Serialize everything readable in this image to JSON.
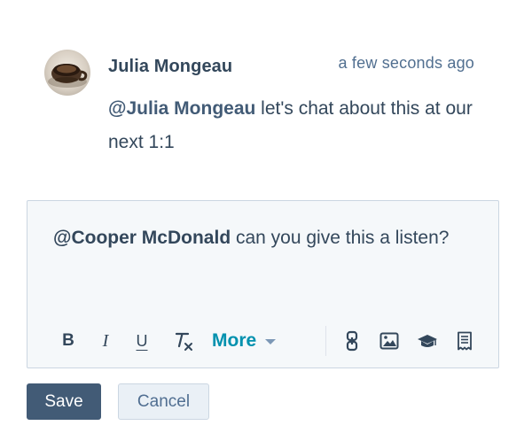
{
  "comment": {
    "author": "Julia Mongeau",
    "timestamp": "a few seconds ago",
    "mention": "@Julia Mongeau",
    "text": " let's chat about this at our next 1:1"
  },
  "editor": {
    "mention": "@Cooper McDonald",
    "text": " can you give this a listen?"
  },
  "toolbar": {
    "bold_label": "B",
    "italic_label": "I",
    "underline_label": "U",
    "more_label": "More",
    "icons": [
      "bold-icon",
      "italic-icon",
      "underline-icon",
      "clear-format-icon",
      "link-icon",
      "image-icon",
      "video-icon",
      "snippet-icon"
    ]
  },
  "actions": {
    "save_label": "Save",
    "cancel_label": "Cancel"
  },
  "colors": {
    "text": "#33475b",
    "accent": "#0091ae",
    "primary_button": "#425b76",
    "secondary_button": "#eaf0f6",
    "editor_background": "#f5f8fa",
    "border": "#cbd6e2"
  }
}
